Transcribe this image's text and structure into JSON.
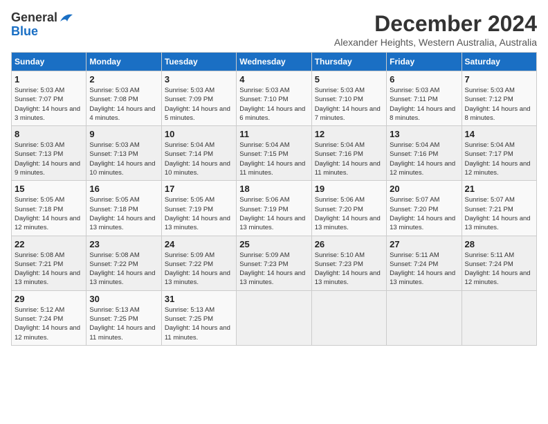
{
  "logo": {
    "general": "General",
    "blue": "Blue"
  },
  "header": {
    "month_year": "December 2024",
    "location": "Alexander Heights, Western Australia, Australia"
  },
  "days_of_week": [
    "Sunday",
    "Monday",
    "Tuesday",
    "Wednesday",
    "Thursday",
    "Friday",
    "Saturday"
  ],
  "weeks": [
    [
      {
        "day": "1",
        "sunrise": "5:03 AM",
        "sunset": "7:07 PM",
        "daylight": "14 hours and 3 minutes."
      },
      {
        "day": "2",
        "sunrise": "5:03 AM",
        "sunset": "7:08 PM",
        "daylight": "14 hours and 4 minutes."
      },
      {
        "day": "3",
        "sunrise": "5:03 AM",
        "sunset": "7:09 PM",
        "daylight": "14 hours and 5 minutes."
      },
      {
        "day": "4",
        "sunrise": "5:03 AM",
        "sunset": "7:10 PM",
        "daylight": "14 hours and 6 minutes."
      },
      {
        "day": "5",
        "sunrise": "5:03 AM",
        "sunset": "7:10 PM",
        "daylight": "14 hours and 7 minutes."
      },
      {
        "day": "6",
        "sunrise": "5:03 AM",
        "sunset": "7:11 PM",
        "daylight": "14 hours and 8 minutes."
      },
      {
        "day": "7",
        "sunrise": "5:03 AM",
        "sunset": "7:12 PM",
        "daylight": "14 hours and 8 minutes."
      }
    ],
    [
      {
        "day": "8",
        "sunrise": "5:03 AM",
        "sunset": "7:13 PM",
        "daylight": "14 hours and 9 minutes."
      },
      {
        "day": "9",
        "sunrise": "5:03 AM",
        "sunset": "7:13 PM",
        "daylight": "14 hours and 10 minutes."
      },
      {
        "day": "10",
        "sunrise": "5:04 AM",
        "sunset": "7:14 PM",
        "daylight": "14 hours and 10 minutes."
      },
      {
        "day": "11",
        "sunrise": "5:04 AM",
        "sunset": "7:15 PM",
        "daylight": "14 hours and 11 minutes."
      },
      {
        "day": "12",
        "sunrise": "5:04 AM",
        "sunset": "7:16 PM",
        "daylight": "14 hours and 11 minutes."
      },
      {
        "day": "13",
        "sunrise": "5:04 AM",
        "sunset": "7:16 PM",
        "daylight": "14 hours and 12 minutes."
      },
      {
        "day": "14",
        "sunrise": "5:04 AM",
        "sunset": "7:17 PM",
        "daylight": "14 hours and 12 minutes."
      }
    ],
    [
      {
        "day": "15",
        "sunrise": "5:05 AM",
        "sunset": "7:18 PM",
        "daylight": "14 hours and 12 minutes."
      },
      {
        "day": "16",
        "sunrise": "5:05 AM",
        "sunset": "7:18 PM",
        "daylight": "14 hours and 13 minutes."
      },
      {
        "day": "17",
        "sunrise": "5:05 AM",
        "sunset": "7:19 PM",
        "daylight": "14 hours and 13 minutes."
      },
      {
        "day": "18",
        "sunrise": "5:06 AM",
        "sunset": "7:19 PM",
        "daylight": "14 hours and 13 minutes."
      },
      {
        "day": "19",
        "sunrise": "5:06 AM",
        "sunset": "7:20 PM",
        "daylight": "14 hours and 13 minutes."
      },
      {
        "day": "20",
        "sunrise": "5:07 AM",
        "sunset": "7:20 PM",
        "daylight": "14 hours and 13 minutes."
      },
      {
        "day": "21",
        "sunrise": "5:07 AM",
        "sunset": "7:21 PM",
        "daylight": "14 hours and 13 minutes."
      }
    ],
    [
      {
        "day": "22",
        "sunrise": "5:08 AM",
        "sunset": "7:21 PM",
        "daylight": "14 hours and 13 minutes."
      },
      {
        "day": "23",
        "sunrise": "5:08 AM",
        "sunset": "7:22 PM",
        "daylight": "14 hours and 13 minutes."
      },
      {
        "day": "24",
        "sunrise": "5:09 AM",
        "sunset": "7:22 PM",
        "daylight": "14 hours and 13 minutes."
      },
      {
        "day": "25",
        "sunrise": "5:09 AM",
        "sunset": "7:23 PM",
        "daylight": "14 hours and 13 minutes."
      },
      {
        "day": "26",
        "sunrise": "5:10 AM",
        "sunset": "7:23 PM",
        "daylight": "14 hours and 13 minutes."
      },
      {
        "day": "27",
        "sunrise": "5:11 AM",
        "sunset": "7:24 PM",
        "daylight": "14 hours and 13 minutes."
      },
      {
        "day": "28",
        "sunrise": "5:11 AM",
        "sunset": "7:24 PM",
        "daylight": "14 hours and 12 minutes."
      }
    ],
    [
      {
        "day": "29",
        "sunrise": "5:12 AM",
        "sunset": "7:24 PM",
        "daylight": "14 hours and 12 minutes."
      },
      {
        "day": "30",
        "sunrise": "5:13 AM",
        "sunset": "7:25 PM",
        "daylight": "14 hours and 11 minutes."
      },
      {
        "day": "31",
        "sunrise": "5:13 AM",
        "sunset": "7:25 PM",
        "daylight": "14 hours and 11 minutes."
      },
      null,
      null,
      null,
      null
    ]
  ]
}
